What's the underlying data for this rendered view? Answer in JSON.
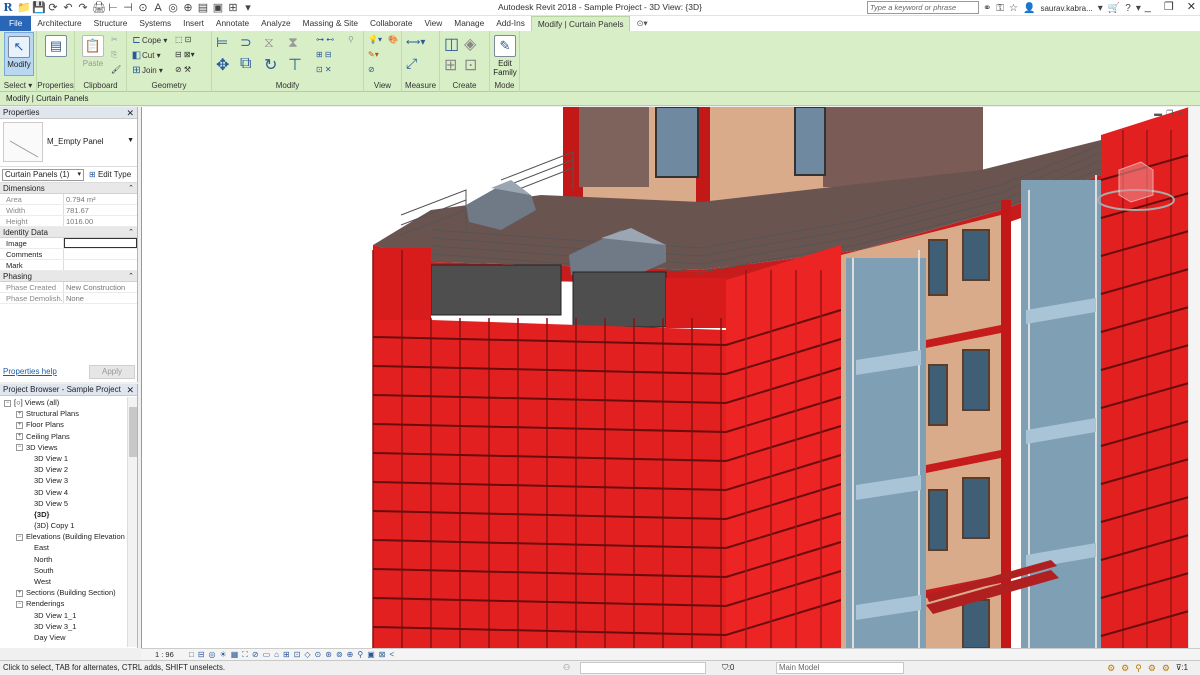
{
  "title_bar": {
    "window_title": "Autodesk Revit 2018 -     Sample Project - 3D View: {3D}",
    "search_placeholder": "Type a keyword or phrase",
    "user": "saurav.kabra...",
    "qat_icons": [
      "revit-logo",
      "open-icon",
      "save-icon",
      "sync-icon",
      "undo-icon",
      "redo-icon",
      "print-icon",
      "measure-icon",
      "dimension-icon",
      "tag-icon",
      "text-icon",
      "3d-view-icon",
      "section-icon",
      "thin-lines-icon",
      "close-hidden-icon",
      "switch-windows-icon",
      "customize-icon"
    ],
    "qat_glyphs": [
      "R",
      "📁",
      "💾",
      "⟳",
      "↶",
      "↷",
      "🖨",
      "⊢",
      "⊣",
      "⊙",
      "A",
      "◎",
      "⊕",
      "▤",
      "▣",
      "⊞",
      "▾"
    ],
    "window_controls": [
      "_",
      "❐",
      "✕"
    ]
  },
  "tabs": [
    "File",
    "Architecture",
    "Structure",
    "Systems",
    "Insert",
    "Annotate",
    "Analyze",
    "Massing & Site",
    "Collaborate",
    "View",
    "Manage",
    "Add-Ins",
    "Modify | Curtain Panels",
    "⊙▾"
  ],
  "active_tab_index": 12,
  "ribbon": {
    "select": {
      "button": "Modify",
      "label": "Select ▾"
    },
    "properties": {
      "button": "",
      "label": "Properties"
    },
    "clipboard": {
      "paste": "Paste",
      "label": "Clipboard"
    },
    "geometry": {
      "cope": "Cope ▾",
      "cut": "Cut ▾",
      "join": "Join ▾",
      "label": "Geometry"
    },
    "modify": {
      "label": "Modify"
    },
    "view": {
      "label": "View"
    },
    "measure": {
      "label": "Measure"
    },
    "create": {
      "label": "Create"
    },
    "mode": {
      "button_line1": "Edit",
      "button_line2": "Family",
      "label": "Mode"
    }
  },
  "context_bar": "Modify | Curtain Panels",
  "properties": {
    "header": "Properties",
    "type_name": "M_Empty Panel",
    "instance_selector": "Curtain Panels (1)",
    "edit_type": "Edit Type",
    "groups": [
      {
        "name": "Dimensions",
        "rows": [
          [
            "Area",
            "0.794 m²"
          ],
          [
            "Width",
            "781.67"
          ],
          [
            "Height",
            "1016.00"
          ]
        ]
      },
      {
        "name": "Identity Data",
        "rows": [
          [
            "Image",
            ""
          ],
          [
            "Comments",
            ""
          ],
          [
            "Mark",
            ""
          ]
        ]
      },
      {
        "name": "Phasing",
        "rows": [
          [
            "Phase Created",
            "New Construction"
          ],
          [
            "Phase Demolish...",
            "None"
          ]
        ]
      }
    ],
    "help_link": "Properties help",
    "apply": "Apply"
  },
  "project_browser": {
    "header": "Project Browser - Sample Project",
    "items": [
      {
        "text": "[○] Views (all)",
        "level": 0,
        "exp": "−"
      },
      {
        "text": "Structural Plans",
        "level": 1,
        "exp": "+"
      },
      {
        "text": "Floor Plans",
        "level": 1,
        "exp": "+"
      },
      {
        "text": "Ceiling Plans",
        "level": 1,
        "exp": "+"
      },
      {
        "text": "3D Views",
        "level": 1,
        "exp": "−"
      },
      {
        "text": "3D View 1",
        "level": 2
      },
      {
        "text": "3D View 2",
        "level": 2
      },
      {
        "text": "3D View 3",
        "level": 2
      },
      {
        "text": "3D View 4",
        "level": 2
      },
      {
        "text": "3D View 5",
        "level": 2
      },
      {
        "text": "{3D}",
        "level": 2,
        "bold": true
      },
      {
        "text": "{3D} Copy 1",
        "level": 2
      },
      {
        "text": "Elevations (Building Elevation",
        "level": 1,
        "exp": "−"
      },
      {
        "text": "East",
        "level": 2
      },
      {
        "text": "North",
        "level": 2
      },
      {
        "text": "South",
        "level": 2
      },
      {
        "text": "West",
        "level": 2
      },
      {
        "text": "Sections (Building Section)",
        "level": 1,
        "exp": "+"
      },
      {
        "text": "Renderings",
        "level": 1,
        "exp": "−"
      },
      {
        "text": "3D View 1_1",
        "level": 2
      },
      {
        "text": "3D View 3_1",
        "level": 2
      },
      {
        "text": "Day View",
        "level": 2
      }
    ]
  },
  "view_bar": {
    "scale": "1 : 96",
    "controls": [
      "□",
      "⊟",
      "◎",
      "☀",
      "▦",
      "⛶",
      "⊘",
      "▭",
      "⌂",
      "⊞",
      "⊡",
      "◇",
      "⊙",
      "⊛",
      "⊚",
      "⊕",
      "⚲",
      "▣",
      "⊠",
      "<"
    ]
  },
  "status": {
    "text": "Click to select, TAB for alternates, CTRL adds, SHIFT unselects.",
    "zoom": ":0",
    "model": "Main Model",
    "selected": "⊽:1"
  },
  "colors": {
    "ribbon": "#d8eec6",
    "file_tab": "#2a66b8",
    "panel_red": "#e02020",
    "glass": "#7e9fb4",
    "wall_tan": "#d8ac8c",
    "roof": "#6a5450"
  }
}
